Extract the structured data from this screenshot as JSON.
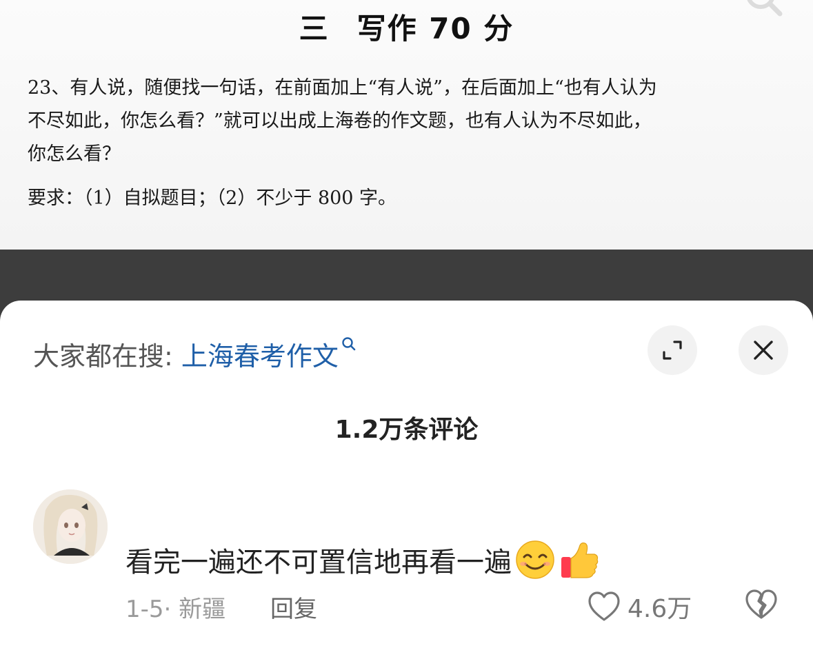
{
  "document": {
    "heading_part1": "三",
    "heading_part2": "写作",
    "heading_part3": "70 分",
    "question_line1": "23、有人说，随便找一句话，在前面加上“有人说”，在后面加上“也有人认为",
    "question_line2": "不尽如此，你怎么看？”就可以出成上海卷的作文题，也有人认为不尽如此，",
    "question_line3": "你怎么看？",
    "requirement": "要求：（1）自拟题目；（2）不少于 800 字。"
  },
  "trending": {
    "prefix": "大家都在搜",
    "colon": ":",
    "link_text": "上海春考作文"
  },
  "comments_header": {
    "count_text": "1.2万条评论"
  },
  "comment": {
    "text": "看完一遍还不可置信地再看一遍",
    "emojis": [
      "smiling-face-emoji",
      "thumbs-up-emoji"
    ],
    "date": "1-5",
    "location_sep": "·",
    "location": "新疆",
    "reply_label": "回复",
    "like_count": "4.6万"
  },
  "colors": {
    "link": "#1f5fa8",
    "sheet_bg": "#ffffff",
    "dim_bg": "#3d3d3d",
    "button_bg": "#f2f2f2"
  }
}
